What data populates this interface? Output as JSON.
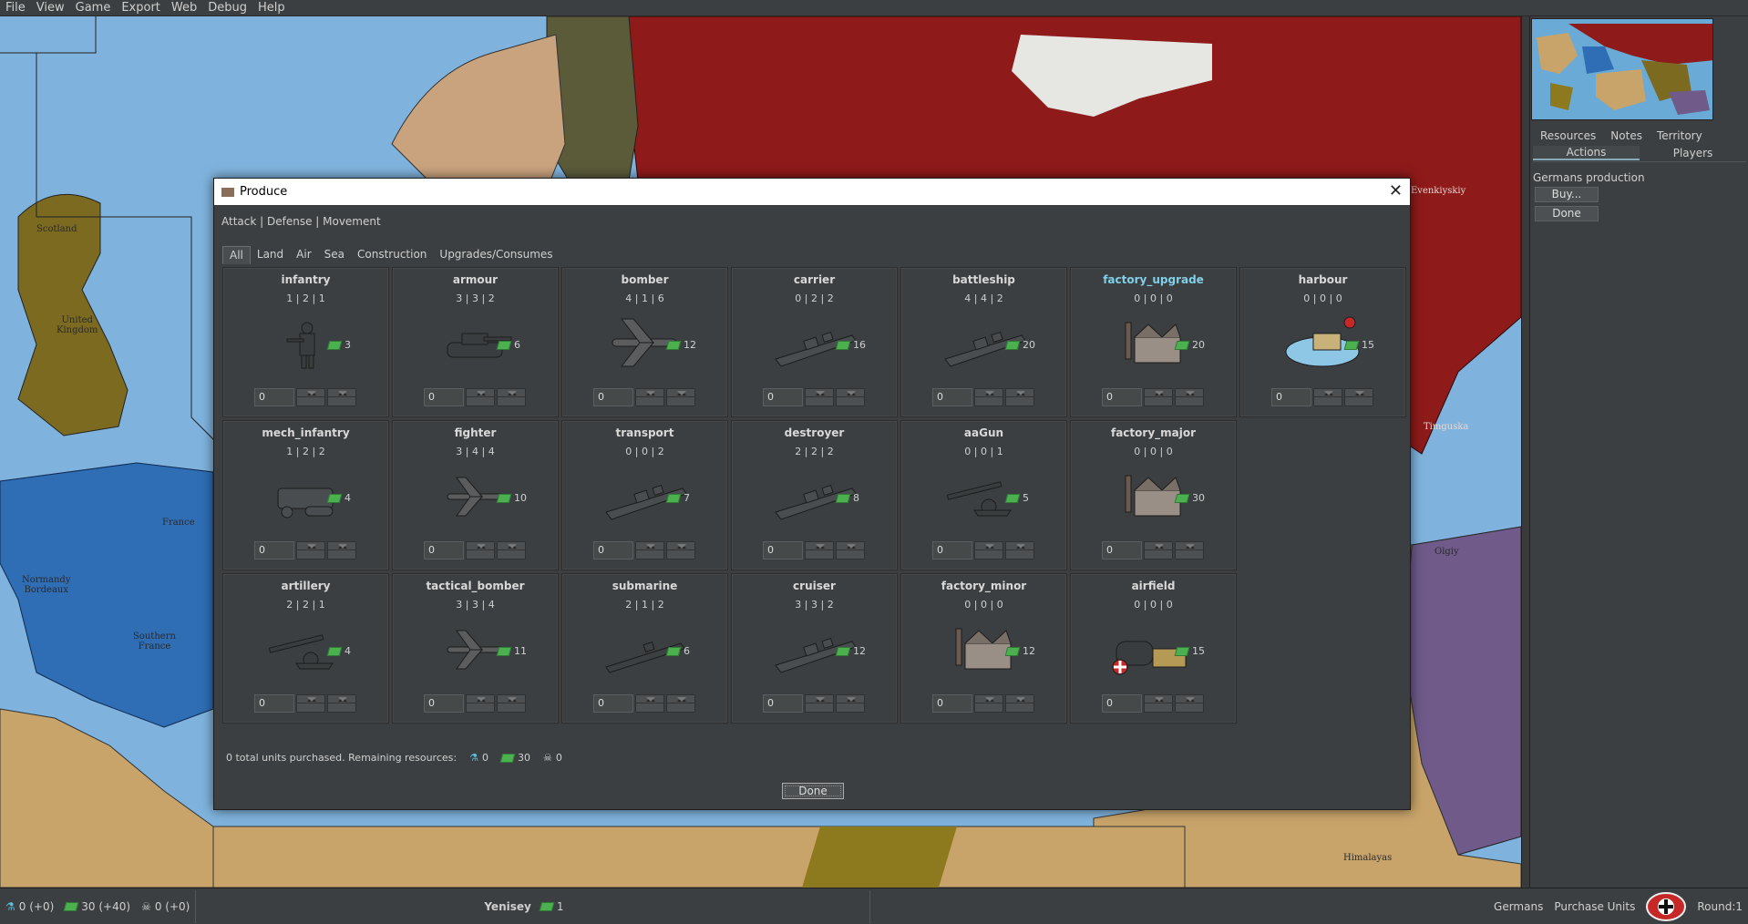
{
  "menu": [
    "File",
    "View",
    "Game",
    "Export",
    "Web",
    "Debug",
    "Help"
  ],
  "map": {
    "labels": {
      "scotland": "Scotland",
      "uk": "United\nKingdom",
      "france": "France",
      "normandy": "Normandy\nBordeaux",
      "southern_france": "Southern\nFrance",
      "evenkiyskiy": "Evenkiyskiy",
      "timguska": "Timguska",
      "olgiy": "Olgiy",
      "himalayas": "Himalayas"
    }
  },
  "right_panel": {
    "tabs_row1": [
      "Resources",
      "Notes",
      "Territory"
    ],
    "tabs_row2": [
      "Actions",
      "Players"
    ],
    "active_tab": "Actions",
    "title": "Germans production",
    "buy_label": "Buy...",
    "done_label": "Done"
  },
  "dialog": {
    "title": "Produce",
    "close": "✕",
    "stats_header": "Attack | Defense | Movement",
    "tabs": [
      "All",
      "Land",
      "Air",
      "Sea",
      "Construction",
      "Upgrades/Consumes"
    ],
    "active_tab": "All",
    "units": [
      {
        "name": "infantry",
        "stats": "1 | 2 | 1",
        "cost": "3",
        "qty": "0",
        "art": "infantry"
      },
      {
        "name": "armour",
        "stats": "3 | 3 | 2",
        "cost": "6",
        "qty": "0",
        "art": "tank"
      },
      {
        "name": "bomber",
        "stats": "4 | 1 | 6",
        "cost": "12",
        "qty": "0",
        "art": "plane-big"
      },
      {
        "name": "carrier",
        "stats": "0 | 2 | 2",
        "cost": "16",
        "qty": "0",
        "art": "ship"
      },
      {
        "name": "battleship",
        "stats": "4 | 4 | 2",
        "cost": "20",
        "qty": "0",
        "art": "ship"
      },
      {
        "name": "factory_upgrade",
        "stats": "0 | 0 | 0",
        "cost": "20",
        "qty": "0",
        "art": "factory",
        "highlight": true
      },
      {
        "name": "harbour",
        "stats": "0 | 0 | 0",
        "cost": "15",
        "qty": "0",
        "art": "harbour"
      },
      {
        "name": "mech_infantry",
        "stats": "1 | 2 | 2",
        "cost": "4",
        "qty": "0",
        "art": "halftrack"
      },
      {
        "name": "fighter",
        "stats": "3 | 4 | 4",
        "cost": "10",
        "qty": "0",
        "art": "plane"
      },
      {
        "name": "transport",
        "stats": "0 | 0 | 2",
        "cost": "7",
        "qty": "0",
        "art": "ship"
      },
      {
        "name": "destroyer",
        "stats": "2 | 2 | 2",
        "cost": "8",
        "qty": "0",
        "art": "ship"
      },
      {
        "name": "aaGun",
        "stats": "0 | 0 | 1",
        "cost": "5",
        "qty": "0",
        "art": "gun"
      },
      {
        "name": "factory_major",
        "stats": "0 | 0 | 0",
        "cost": "30",
        "qty": "0",
        "art": "factory"
      },
      {
        "name": "artillery",
        "stats": "2 | 2 | 1",
        "cost": "4",
        "qty": "0",
        "art": "gun"
      },
      {
        "name": "tactical_bomber",
        "stats": "3 | 3 | 4",
        "cost": "11",
        "qty": "0",
        "art": "plane"
      },
      {
        "name": "submarine",
        "stats": "2 | 1 | 2",
        "cost": "6",
        "qty": "0",
        "art": "sub"
      },
      {
        "name": "cruiser",
        "stats": "3 | 3 | 2",
        "cost": "12",
        "qty": "0",
        "art": "ship"
      },
      {
        "name": "factory_minor",
        "stats": "0 | 0 | 0",
        "cost": "12",
        "qty": "0",
        "art": "factory"
      },
      {
        "name": "airfield",
        "stats": "0 | 0 | 0",
        "cost": "15",
        "qty": "0",
        "art": "airfield"
      }
    ],
    "summary": "0 total units purchased. Remaining resources:",
    "resources": {
      "tech": "0",
      "pus": "30",
      "other": "0"
    },
    "done_label": "Done"
  },
  "statusbar": {
    "tech": "0 (+0)",
    "pus": "30 (+40)",
    "skull": "0 (+0)",
    "territory": "Yenisey",
    "territory_value": "1",
    "nation": "Germans",
    "phase": "Purchase Units",
    "round": "Round:1"
  },
  "colors": {
    "sea": "#7fb3dd",
    "allies_blue": "#2f6db5",
    "uk_olive": "#7b6a1f",
    "russia_red": "#8e1a1a",
    "neutral_tan": "#c8a46a",
    "purple": "#6f5a8a",
    "dialog_bg": "#3c3f41"
  }
}
